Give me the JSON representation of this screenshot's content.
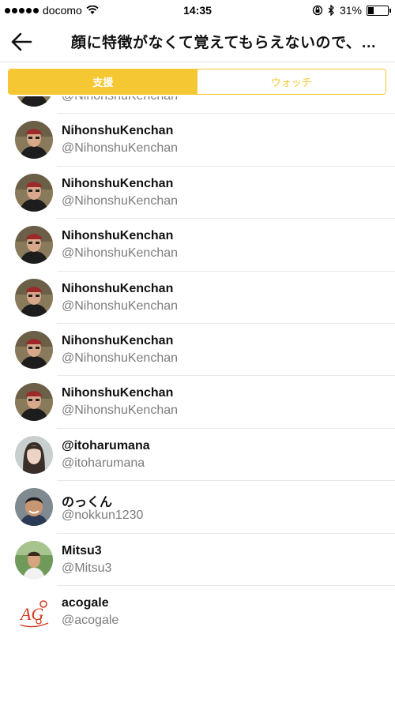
{
  "status_bar": {
    "carrier": "docomo",
    "time": "14:35",
    "battery": "31%",
    "battery_level": 0.31
  },
  "header": {
    "title": "顔に特徴がなくて覚えてもらえないので、…"
  },
  "tabs": [
    {
      "label": "支援",
      "active": true
    },
    {
      "label": "ウォッチ",
      "active": false
    }
  ],
  "accent_color": "#f5c833",
  "users": [
    {
      "name": "NihonshuKenchan",
      "handle": "@NihonshuKenchan",
      "avatar": "man-red-cap"
    },
    {
      "name": "NihonshuKenchan",
      "handle": "@NihonshuKenchan",
      "avatar": "man-red-cap"
    },
    {
      "name": "NihonshuKenchan",
      "handle": "@NihonshuKenchan",
      "avatar": "man-red-cap"
    },
    {
      "name": "NihonshuKenchan",
      "handle": "@NihonshuKenchan",
      "avatar": "man-red-cap"
    },
    {
      "name": "NihonshuKenchan",
      "handle": "@NihonshuKenchan",
      "avatar": "man-red-cap"
    },
    {
      "name": "NihonshuKenchan",
      "handle": "@NihonshuKenchan",
      "avatar": "man-red-cap"
    },
    {
      "name": "NihonshuKenchan",
      "handle": "@NihonshuKenchan",
      "avatar": "man-red-cap"
    },
    {
      "name": "@itoharumana",
      "handle": "@itoharumana",
      "avatar": "woman-portrait"
    },
    {
      "name": "のっくん",
      "handle": "@nokkun1230",
      "avatar": "man-smiling"
    },
    {
      "name": "Mitsu3",
      "handle": "@Mitsu3",
      "avatar": "man-outdoor"
    },
    {
      "name": "acogale",
      "handle": "@acogale",
      "avatar": "acogale-logo"
    }
  ]
}
